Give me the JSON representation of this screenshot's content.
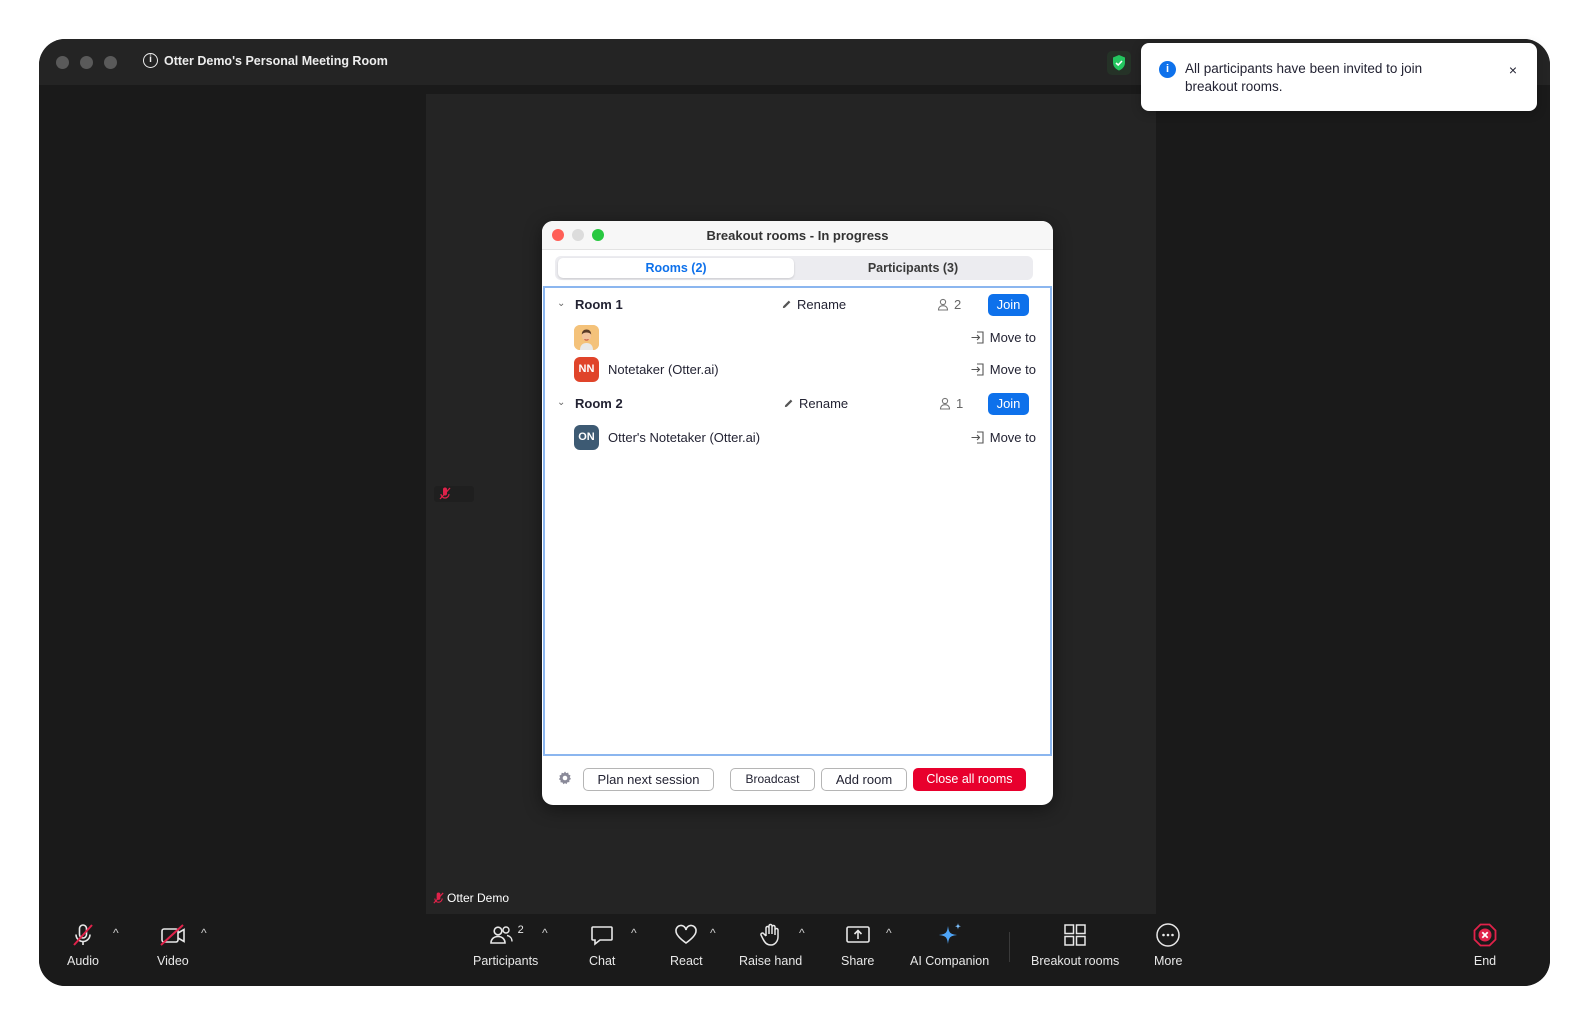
{
  "window": {
    "title": "Otter Demo's Personal Meeting Room",
    "self_name": "Otter Demo"
  },
  "toast": {
    "message": "All participants have been invited to join breakout rooms.",
    "close_glyph": "×",
    "info_glyph": "i"
  },
  "dialog": {
    "title": "Breakout rooms - In progress",
    "tabs": [
      "Rooms (2)",
      "Participants (3)"
    ],
    "active_tab": "Rooms (2)",
    "rooms": [
      {
        "name": "Room 1",
        "rename_label": "Rename",
        "count": "2",
        "join_label": "Join",
        "participants": [
          {
            "name": "",
            "initials": "",
            "avatar_type": "photo",
            "move_label": "Move to"
          },
          {
            "name": "Notetaker (Otter.ai)",
            "initials": "NN",
            "avatar_color": "#e0442a",
            "move_label": "Move to"
          }
        ]
      },
      {
        "name": "Room 2",
        "rename_label": "Rename",
        "count": "1",
        "join_label": "Join",
        "participants": [
          {
            "name": "Otter's Notetaker (Otter.ai)",
            "initials": "ON",
            "avatar_color": "#3d5a73",
            "move_label": "Move to"
          }
        ]
      }
    ],
    "footer": {
      "plan_label": "Plan next session",
      "broadcast_label": "Broadcast",
      "add_room_label": "Add room",
      "close_all_label": "Close all rooms"
    }
  },
  "toolbar": {
    "audio": "Audio",
    "video": "Video",
    "participants": "Participants",
    "participants_count": "2",
    "chat": "Chat",
    "react": "React",
    "raise_hand": "Raise hand",
    "share": "Share",
    "ai_companion": "AI Companion",
    "breakout_rooms": "Breakout rooms",
    "more": "More",
    "end": "End"
  },
  "colors": {
    "accent": "#0e71eb",
    "danger": "#e8002d",
    "muted_red": "#e0224a",
    "ai_blue": "#4ea4f7"
  }
}
